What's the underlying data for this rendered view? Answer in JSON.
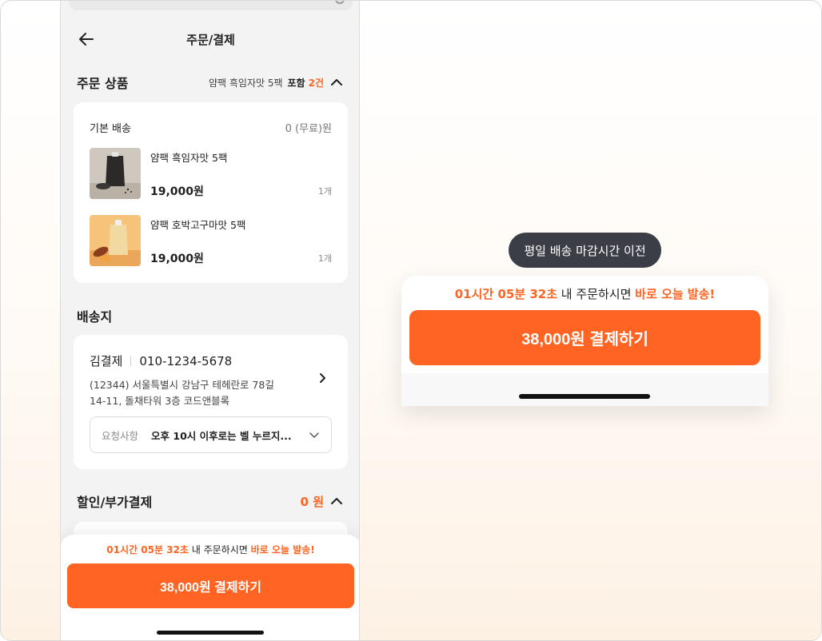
{
  "header": {
    "title": "주문/결제"
  },
  "order_section": {
    "title": "주문 상품",
    "summary_product": "얌팩 흑임자맛 5팩",
    "summary_included": "포함",
    "summary_count": "2건"
  },
  "shipping": {
    "label": "기본 배송",
    "fee": "0 (무료)원"
  },
  "products": [
    {
      "name": "얌팩 흑임자맛 5팩",
      "price": "19,000원",
      "qty": "1개",
      "image": "black-sesame-pouch-image"
    },
    {
      "name": "얌팩 호박고구마맛 5팩",
      "price": "19,000원",
      "qty": "1개",
      "image": "sweet-potato-pouch-image"
    }
  ],
  "address_section": {
    "title": "배송지",
    "name": "김결제",
    "phone": "010-1234-5678",
    "line1": "(12344) 서울특별시 강남구 테헤란로 78길",
    "line2": "14-11, 돌채타워 3층 코드앤블록",
    "request_label": "요청사항",
    "request_value": "오후 10시 이후로는 벨 누르지..."
  },
  "discount_section": {
    "title": "할인/부가결제",
    "amount": "0 원"
  },
  "checkout": {
    "deadline_time": "01시간 05분 32초",
    "deadline_mid": " 내 주문하시면 ",
    "deadline_tail": "바로 오늘 발송!",
    "pay_label": "38,000원 결제하기"
  },
  "zoom": {
    "tooltip": "평일 배송 마감시간 이전"
  },
  "colors": {
    "accent": "#ff6422",
    "tooltip_bg": "#3b3e46",
    "page_bg": "#f3f3f3"
  }
}
